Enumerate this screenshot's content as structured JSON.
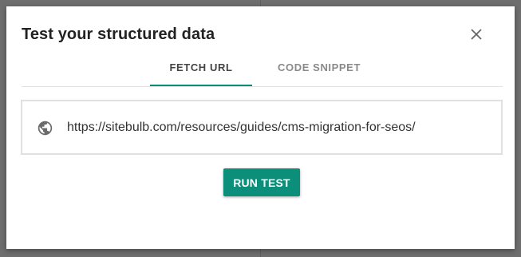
{
  "dialog": {
    "title": "Test your structured data",
    "close_icon": "close-icon"
  },
  "tabs": [
    {
      "label": "FETCH URL",
      "active": true
    },
    {
      "label": "CODE SNIPPET",
      "active": false
    }
  ],
  "url_input": {
    "icon": "globe-icon",
    "value": "https://sitebulb.com/resources/guides/cms-migration-for-seos/"
  },
  "actions": {
    "run_label": "RUN TEST"
  },
  "colors": {
    "accent": "#0b8f7a",
    "backdrop": "#6e6e6e"
  }
}
